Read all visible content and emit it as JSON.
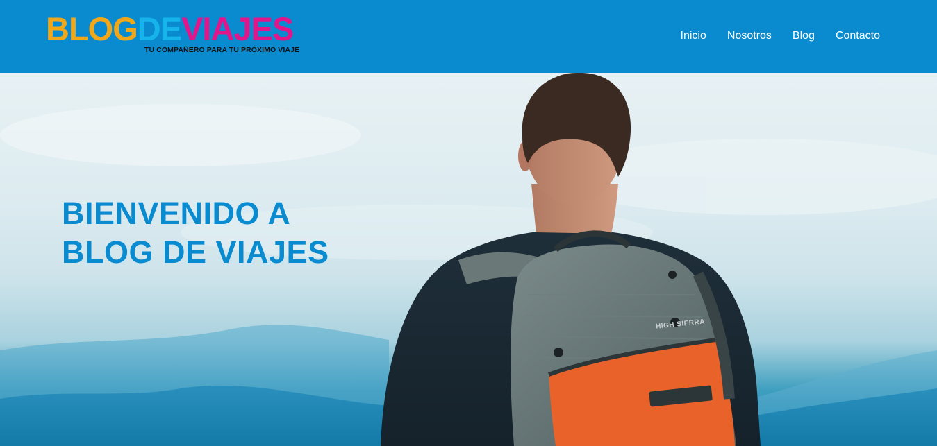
{
  "header": {
    "logo": {
      "parts": [
        {
          "text": "BLOG",
          "color": "#f0a71a"
        },
        {
          "text": "DE",
          "color": "#17b4ec"
        },
        {
          "text": "VIAJES",
          "color": "#e0168a"
        }
      ],
      "tagline": "TU COMPAÑERO PARA TU PRÓXIMO VIAJE"
    },
    "nav": [
      {
        "label": "Inicio"
      },
      {
        "label": "Nosotros"
      },
      {
        "label": "Blog"
      },
      {
        "label": "Contacto"
      }
    ]
  },
  "hero": {
    "heading_line1": "BIENVENIDO A",
    "heading_line2": "BLOG DE VIAJES",
    "backpack_brand": "HIGH SIERRA"
  },
  "colors": {
    "header_bg": "#0a8bd0",
    "heading": "#0a8bd0",
    "nav_text": "#ffffff",
    "backpack_orange": "#e8622a",
    "backpack_grey": "#5f6e6e"
  }
}
